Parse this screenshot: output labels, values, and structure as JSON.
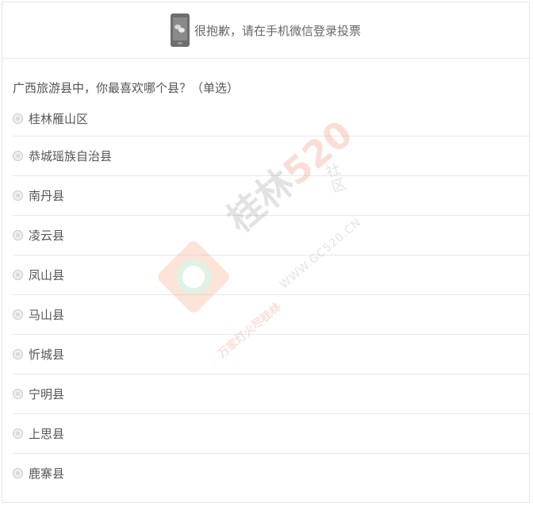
{
  "notice": {
    "text": "很抱歉，请在手机微信登录投票",
    "icon": "phone-wechat-icon"
  },
  "question": {
    "text": "广西旅游县中，你最喜欢哪个县？（单选）"
  },
  "options": [
    {
      "label": "桂林雁山区",
      "selected": false
    },
    {
      "label": "恭城瑶族自治县",
      "selected": false
    },
    {
      "label": "南丹县",
      "selected": false
    },
    {
      "label": "凌云县",
      "selected": false
    },
    {
      "label": "凤山县",
      "selected": false
    },
    {
      "label": "马山县",
      "selected": false
    },
    {
      "label": "忻城县",
      "selected": false
    },
    {
      "label": "宁明县",
      "selected": false
    },
    {
      "label": "上思县",
      "selected": false
    },
    {
      "label": "鹿寨县",
      "selected": false
    }
  ],
  "watermark": {
    "brand_prefix": "桂林",
    "brand_number": "520",
    "community": "社区",
    "url": "WWW.GC520.CN",
    "slogan": "万家灯火尽桂林"
  },
  "colors": {
    "border": "#e8e8e8",
    "text": "#555555",
    "watermark_accent": "#f08a6a"
  }
}
